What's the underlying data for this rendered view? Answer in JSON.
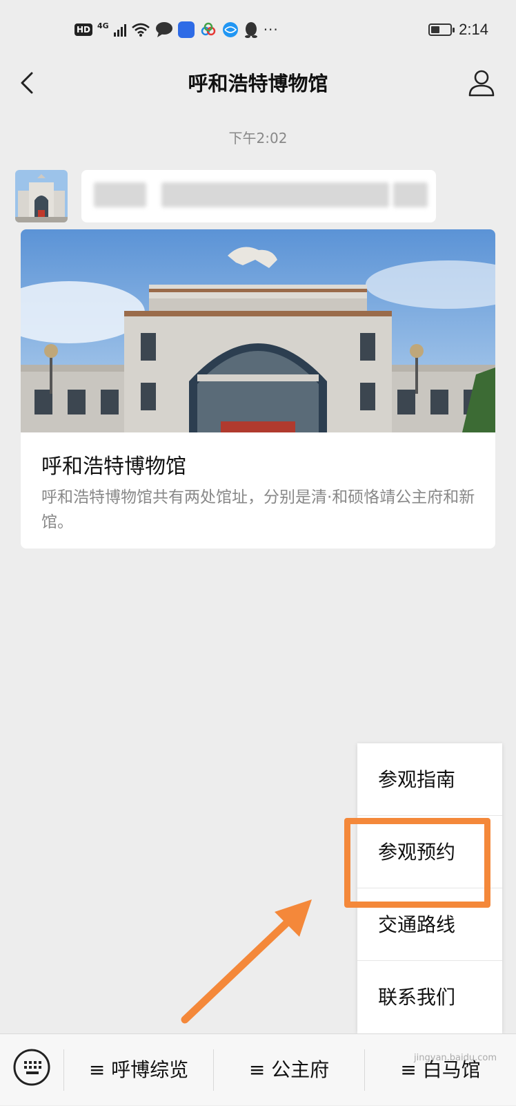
{
  "status_bar": {
    "hd": "HD",
    "network": "4G",
    "more": "···",
    "time": "2:14",
    "battery_level": 0.45
  },
  "nav": {
    "title": "呼和浩特博物馆"
  },
  "chat": {
    "timestamp": "下午2:02",
    "article": {
      "title": "呼和浩特博物馆",
      "description": "呼和浩特博物馆共有两处馆址，分别是清·和硕恪靖公主府和新馆。"
    }
  },
  "popup_menu": {
    "items": [
      "参观指南",
      "参观预约",
      "交通路线",
      "联系我们"
    ]
  },
  "bottom_menu": {
    "tabs": [
      {
        "label": "≡ 呼博综览"
      },
      {
        "label": "≡ 公主府"
      },
      {
        "label": "≡ 白马馆"
      }
    ]
  },
  "watermark": "jingyan.baidu.com",
  "colors": {
    "accent_highlight": "#f4883a",
    "background": "#ededed"
  }
}
